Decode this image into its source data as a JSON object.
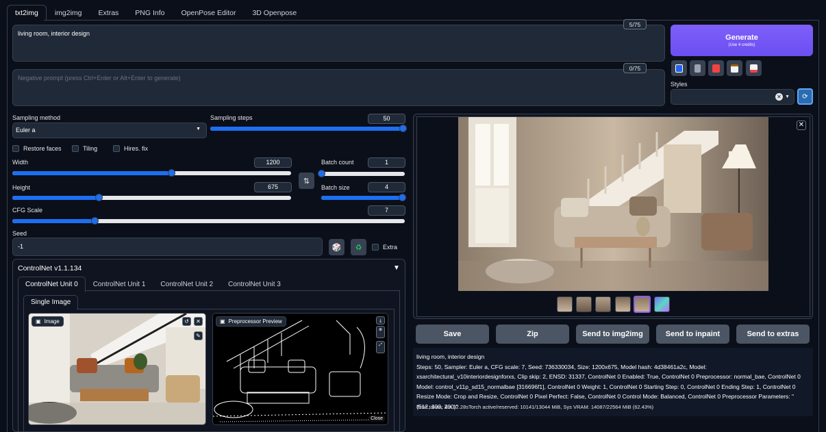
{
  "tabs": [
    "txt2img",
    "img2img",
    "Extras",
    "PNG Info",
    "OpenPose Editor",
    "3D Openpose"
  ],
  "prompt": {
    "value": "living room, interior design",
    "token_count": "5/75"
  },
  "negative_prompt": {
    "placeholder": "Negative prompt (press Ctrl+Enter or Alt+Enter to generate)",
    "token_count": "0/75"
  },
  "generate": {
    "label": "Generate",
    "sublabel": "(Use 4 credits)"
  },
  "styles": {
    "label": "Styles",
    "value": ""
  },
  "sampling_method": {
    "label": "Sampling method",
    "value": "Euler a"
  },
  "sampling_steps": {
    "label": "Sampling steps",
    "value": "50",
    "fraction": 1.0
  },
  "checkboxes": {
    "restore_faces": "Restore faces",
    "tiling": "Tiling",
    "hires_fix": "Hires. fix"
  },
  "width": {
    "label": "Width",
    "value": "1200",
    "fraction": 0.57
  },
  "height": {
    "label": "Height",
    "value": "675",
    "fraction": 0.31
  },
  "batch_count": {
    "label": "Batch count",
    "value": "1",
    "fraction": 0.0
  },
  "batch_size": {
    "label": "Batch size",
    "value": "4",
    "fraction": 1.0
  },
  "cfg_scale": {
    "label": "CFG Scale",
    "value": "7",
    "fraction": 0.21
  },
  "seed": {
    "label": "Seed",
    "value": "-1",
    "extra_label": "Extra"
  },
  "controlnet": {
    "title": "ControlNet v1.1.134",
    "units": [
      "ControlNet Unit 0",
      "ControlNet Unit 1",
      "ControlNet Unit 2",
      "ControlNet Unit 3"
    ],
    "single_image_tab": "Single Image",
    "image_label": "Image",
    "preview_label": "Preprocessor Preview",
    "close_label": "Close"
  },
  "actions": [
    "Save",
    "Zip",
    "Send to img2img",
    "Send to inpaint",
    "Send to extras"
  ],
  "info": {
    "prompt": "living room, interior design",
    "params": "Steps: 50, Sampler: Euler a, CFG scale: 7, Seed: 736330034, Size: 1200x675, Model hash: 4d38461a2c, Model: xsarchitectural_v10interiordesignforxs, Clip skip: 2, ENSD: 31337, ControlNet 0 Enabled: True, ControlNet 0 Preprocessor: normal_bae, ControlNet 0 Model: control_v11p_sd15_normalbae [316696f1], ControlNet 0 Weight: 1, ControlNet 0 Starting Step: 0, ControlNet 0 Ending Step: 1, ControlNet 0 Resize Mode: Crop and Resize, ControlNet 0 Pixel Perfect: False, ControlNet 0 Control Mode: Balanced, ControlNet 0 Preprocessor Parameters: \"(512, 100, 200)\"",
    "time": "Time taken: 4m 32.28sTorch active/reserved: 10141/13044 MiB, Sys VRAM: 14087/22564 MiB (62.43%)"
  },
  "colors": {
    "accent": "#1d6ff2",
    "generate": "#7c5cff",
    "background": "#0b0f19"
  }
}
